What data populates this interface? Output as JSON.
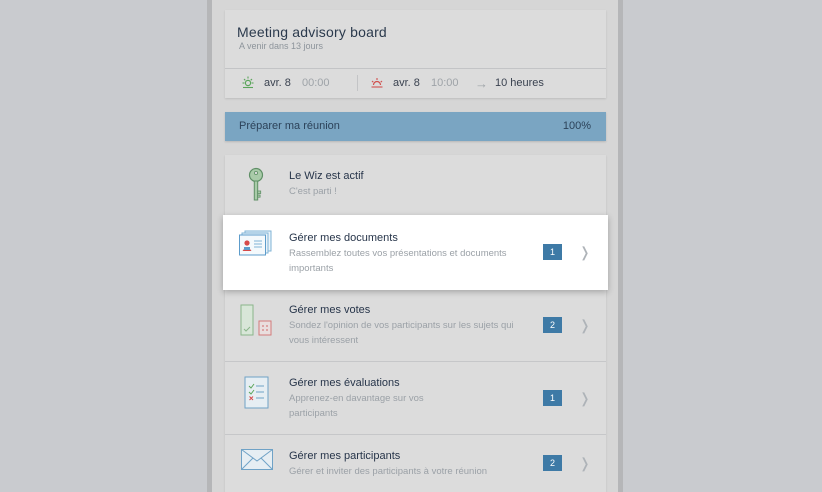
{
  "meeting": {
    "title": "Meeting advisory board",
    "subtitle": "A venir dans 13 jours",
    "start_date": "avr. 8",
    "start_time": "00:00",
    "end_date": "avr. 8",
    "end_time": "10:00",
    "duration": "10 heures"
  },
  "prepare": {
    "label": "Préparer ma réunion",
    "percent": "100%"
  },
  "items": [
    {
      "title": "Le Wiz est actif",
      "description": "C'est parti !",
      "icon": "key-icon"
    },
    {
      "title": "Gérer mes documents",
      "description": "Rassemblez toutes vos présentations et documents importants",
      "badge": "1",
      "chevron": "❭",
      "icon": "documents-icon"
    },
    {
      "title": "Gérer mes votes",
      "description": "Sondez l'opinion de vos participants sur les sujets qui vous intéressent",
      "badge": "2",
      "chevron": "❭",
      "icon": "votes-icon"
    },
    {
      "title": "Gérer mes évaluations",
      "description": "Apprenez-en davantage sur vos participants",
      "badge": "1",
      "chevron": "❭",
      "icon": "checklist-icon"
    },
    {
      "title": "Gérer mes participants",
      "description": "Gérer et inviter des participants à votre réunion",
      "badge": "2",
      "chevron": "❭",
      "icon": "envelope-icon"
    }
  ],
  "colors": {
    "accent_bar": "#7aa5c2",
    "badge": "#3e7aa6",
    "sunrise": "#5aa55a",
    "sunset": "#d2504e"
  }
}
